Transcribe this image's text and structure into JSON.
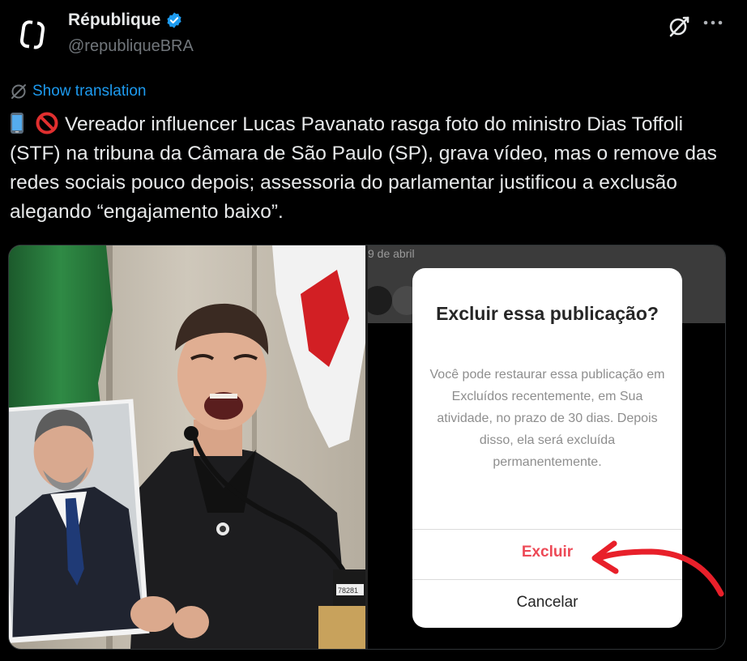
{
  "account": {
    "display_name": "République",
    "handle": "@republiqueBRA"
  },
  "translate": {
    "label": "Show translation"
  },
  "tweet": {
    "text": "Vereador influencer Lucas Pavanato rasga foto do ministro Dias Toffoli (STF) na tribuna da Câmara de São Paulo (SP), grava vídeo, mas o remove das redes sociais pouco depois; assessoria do parlamentar justificou a exclusão alegando “engajamento baixo”."
  },
  "media": {
    "right": {
      "date_label": "9 de abril",
      "dialog_title": "Excluir essa publicação?",
      "dialog_body": "Você pode restaurar essa publicação em Excluídos recentemente, em Sua atividade, no prazo de 30 dias. Depois disso, ela será excluída permanentemente.",
      "delete_label": "Excluir",
      "cancel_label": "Cancelar"
    },
    "left": {
      "mic_label": "78281"
    }
  },
  "colors": {
    "link": "#1d9bf0",
    "verified": "#1d9bf0",
    "delete": "#ed4956",
    "arrow": "#e8202a"
  },
  "icons": [
    "verified-badge-icon",
    "grok-icon",
    "more-icon",
    "translate-icon",
    "mobile-phone-emoji",
    "no-entry-emoji"
  ]
}
